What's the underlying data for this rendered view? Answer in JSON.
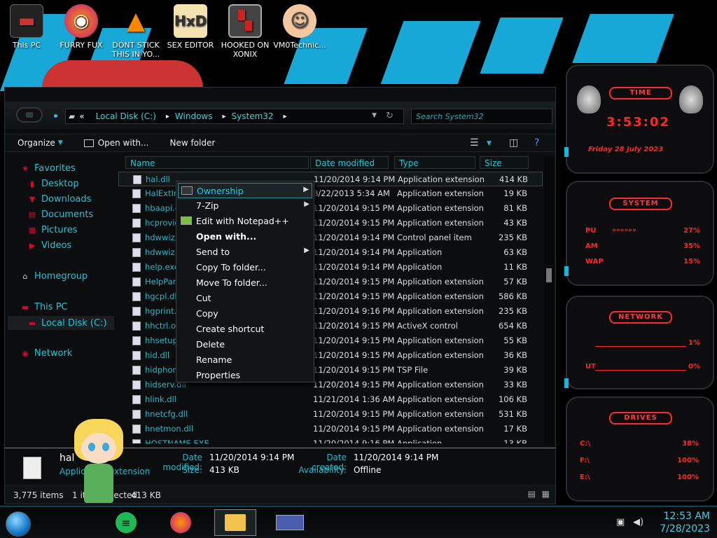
{
  "desktop": {
    "icons": [
      {
        "label": "This PC"
      },
      {
        "label": "FURRY FUX"
      },
      {
        "label": "DONT STICK THIS IN YO..."
      },
      {
        "label": "SEX EDITOR"
      },
      {
        "label": "HOOKED ON XONIX"
      },
      {
        "label": "VM0Technic..."
      }
    ]
  },
  "explorer": {
    "address": {
      "root_chevron": "«",
      "parts": [
        "Local Disk (C:)",
        "Windows",
        "System32"
      ]
    },
    "search_placeholder": "Search System32",
    "toolbar": {
      "organize": "Organize",
      "open_with": "Open with...",
      "new_folder": "New folder"
    },
    "sidebar": {
      "favorites": "Favorites",
      "fav_items": [
        "Desktop",
        "Downloads",
        "Documents",
        "Pictures",
        "Videos"
      ],
      "homegroup": "Homegroup",
      "this_pc": "This PC",
      "local_disk": "Local Disk (C:)",
      "network": "Network"
    },
    "columns": [
      "Name",
      "Date modified",
      "Type",
      "Size"
    ],
    "files": [
      {
        "name": "hal.dll",
        "date": "11/20/2014 9:14 PM",
        "type": "Application extension",
        "size": "414 KB"
      },
      {
        "name": "HalExtInt...",
        "date": "8/22/2013 5:34 AM",
        "type": "Application extension",
        "size": "19 KB"
      },
      {
        "name": "hbaapi.d...",
        "date": "11/20/2014 9:15 PM",
        "type": "Application extension",
        "size": "81 KB"
      },
      {
        "name": "hcprovid...",
        "date": "11/20/2014 9:15 PM",
        "type": "Application extension",
        "size": "43 KB"
      },
      {
        "name": "hdwwiz.c...",
        "date": "11/20/2014 9:14 PM",
        "type": "Control panel item",
        "size": "235 KB"
      },
      {
        "name": "hdwwiz.e...",
        "date": "11/20/2014 9:14 PM",
        "type": "Application",
        "size": "63 KB"
      },
      {
        "name": "help.exe",
        "date": "11/20/2014 9:14 PM",
        "type": "Application",
        "size": "11 KB"
      },
      {
        "name": "HelpPane...",
        "date": "11/20/2014 9:15 PM",
        "type": "Application extension",
        "size": "57 KB"
      },
      {
        "name": "hgcpl.dll",
        "date": "11/20/2014 9:15 PM",
        "type": "Application extension",
        "size": "586 KB"
      },
      {
        "name": "hgprint.d...",
        "date": "11/20/2014 9:16 PM",
        "type": "Application extension",
        "size": "235 KB"
      },
      {
        "name": "hhctrl.oc...",
        "date": "11/20/2014 9:15 PM",
        "type": "ActiveX control",
        "size": "654 KB"
      },
      {
        "name": "hhsetup.d...",
        "date": "11/20/2014 9:15 PM",
        "type": "Application extension",
        "size": "55 KB"
      },
      {
        "name": "hid.dll",
        "date": "11/20/2014 9:15 PM",
        "type": "Application extension",
        "size": "36 KB"
      },
      {
        "name": "hidphone...",
        "date": "11/20/2014 9:15 PM",
        "type": "TSP File",
        "size": "39 KB"
      },
      {
        "name": "hidserv.dll",
        "date": "11/20/2014 9:15 PM",
        "type": "Application extension",
        "size": "33 KB"
      },
      {
        "name": "hlink.dll",
        "date": "11/21/2014 1:36 AM",
        "type": "Application extension",
        "size": "106 KB"
      },
      {
        "name": "hnetcfg.dll",
        "date": "11/20/2014 9:15 PM",
        "type": "Application extension",
        "size": "531 KB"
      },
      {
        "name": "hnetmon.dll",
        "date": "11/20/2014 9:15 PM",
        "type": "Application extension",
        "size": "17 KB"
      },
      {
        "name": "HOSTNAME.EXE",
        "date": "11/20/2014 9:16 PM",
        "type": "Application",
        "size": "13 KB"
      }
    ],
    "details": {
      "name": "hal",
      "type": "Application extension",
      "date_modified_label": "Date modified:",
      "date_modified": "11/20/2014 9:14 PM",
      "size_label": "Size:",
      "size": "413 KB",
      "date_created_label": "Date created:",
      "date_created": "11/20/2014 9:14 PM",
      "availability_label": "Availability:",
      "availability": "Offline"
    },
    "status": {
      "count": "3,775 items",
      "selected": "1 item selected",
      "sel_size": "413 KB"
    }
  },
  "context_menu": [
    {
      "label": "Ownership",
      "submenu": true,
      "highlight": true
    },
    {
      "label": "7-Zip",
      "submenu": true
    },
    {
      "label": "Edit with Notepad++"
    },
    {
      "label": "Open with...",
      "bold": true
    },
    {
      "label": "Send to",
      "submenu": true
    },
    {
      "label": "Copy To folder..."
    },
    {
      "label": "Move To folder..."
    },
    {
      "label": "Cut"
    },
    {
      "label": "Copy"
    },
    {
      "label": "Create shortcut"
    },
    {
      "label": "Delete"
    },
    {
      "label": "Rename"
    },
    {
      "label": "Properties"
    }
  ],
  "gadgets": {
    "time": {
      "title": "TIME",
      "clock": "3:53:02",
      "date": "Friday 28 July 2023"
    },
    "system": {
      "title": "SYSTEM",
      "rows": [
        {
          "label": "PU",
          "value": "27%"
        },
        {
          "label": "AM",
          "value": "35%"
        },
        {
          "label": "WAP",
          "value": "15%"
        }
      ]
    },
    "network": {
      "title": "NETWORK",
      "rows": [
        {
          "label": "",
          "value": "1%"
        },
        {
          "label": "UT",
          "value": "0%"
        }
      ]
    },
    "drives": {
      "title": "DRIVES",
      "rows": [
        {
          "label": "C:\\",
          "value": "38%"
        },
        {
          "label": "F:\\",
          "value": "100%"
        },
        {
          "label": "E:\\",
          "value": "100%"
        }
      ]
    }
  },
  "taskbar": {
    "time": "12:53 AM",
    "date": "7/28/2023"
  },
  "colors": {
    "accent": "#20c6d6",
    "gadget_red": "#ff2626",
    "wall_blue": "#17a8d8"
  }
}
